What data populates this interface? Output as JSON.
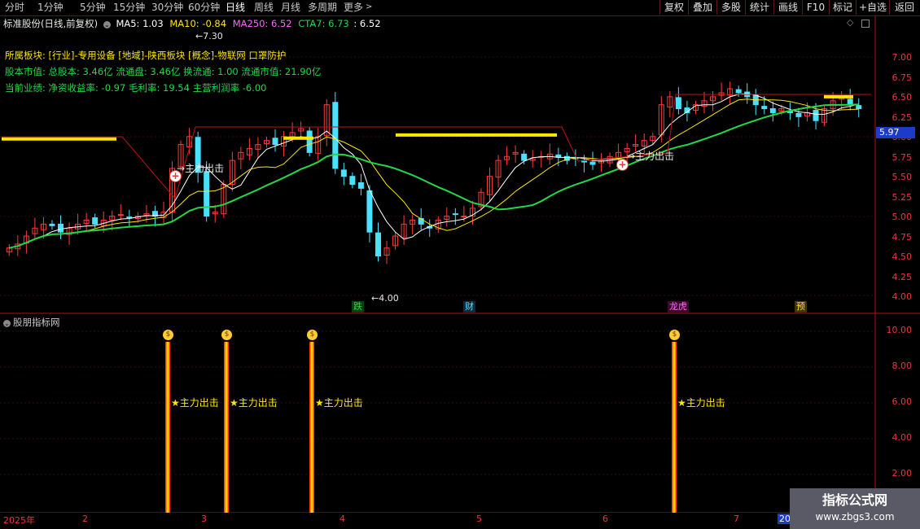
{
  "toolbar": {
    "periods": [
      "分时",
      "1分钟",
      "5分钟",
      "15分钟",
      "30分钟",
      "60分钟",
      "日线",
      "周线",
      "月线",
      "多周期",
      "更多"
    ],
    "active_period": "日线",
    "more_arrow": ">",
    "right_buttons": [
      "复权",
      "叠加",
      "多股",
      "统计",
      "画线",
      "F10",
      "标记",
      "+自选",
      "返回"
    ]
  },
  "main_chart": {
    "title": "标准股份(日线,前复权)",
    "ma_labels": [
      {
        "text": "MA5: 1.03",
        "color": "#ffffff"
      },
      {
        "text": "MA10: -0.84",
        "color": "#ffe600"
      },
      {
        "text": "MA250: 6.52",
        "color": "#ff66ff"
      },
      {
        "text": "CTA7: 6.73",
        "color": "#22d84a"
      },
      {
        "text": ": 6.52",
        "color": "#ffffff"
      }
    ],
    "info_line1": "所属板块: [行业]-专用设备 [地域]-陕西板块 [概念]-物联网 口罩防护",
    "info_line2": "股本市值: 总股本: 3.46亿 流通盘: 3.46亿 换流通: 1.00 流通市值: 21.90亿",
    "info_line3": "当前业绩: 净资收益率: -0.97 毛利率: 19.54 主营利润率 -6.00",
    "price_axis": [
      "7.00",
      "6.75",
      "6.50",
      "6.25",
      "6.00",
      "5.75",
      "5.50",
      "5.25",
      "5.00",
      "4.75",
      "4.50",
      "4.25",
      "4.00"
    ],
    "current_price": "5.97",
    "high_marker": "7.30",
    "low_marker": "4.00",
    "signal_text": "主力出击",
    "events": [
      {
        "text": "跌",
        "color": "#22d84a",
        "bg": "#0b3d12"
      },
      {
        "text": "财",
        "color": "#4ae0ff",
        "bg": "#0b2a3d"
      },
      {
        "text": "龙虎",
        "color": "#ff66ff",
        "bg": "#3d0b2a"
      },
      {
        "text": "预",
        "color": "#ffe600",
        "bg": "#3d320b"
      }
    ],
    "icons": {
      "diamond": "diamond-icon",
      "window": "window-icon",
      "plus": "plus-signal-icon"
    }
  },
  "sub_chart": {
    "title": "股朋指标网",
    "axis": [
      "10.00",
      "8.00",
      "6.00",
      "4.00",
      "2.00"
    ],
    "signal_label": "★主力出击"
  },
  "date_axis": [
    "2025年",
    "2",
    "3",
    "4",
    "5",
    "6",
    "7",
    "20"
  ],
  "watermark": {
    "line1": "指标公式网",
    "line2": "www.zbgs3.com"
  },
  "colors": {
    "up": "#ff3a3a",
    "down": "#4ae0ff",
    "ma_green": "#22d84a",
    "ma_yellow": "#ffe600",
    "axis": "#b01515"
  }
}
